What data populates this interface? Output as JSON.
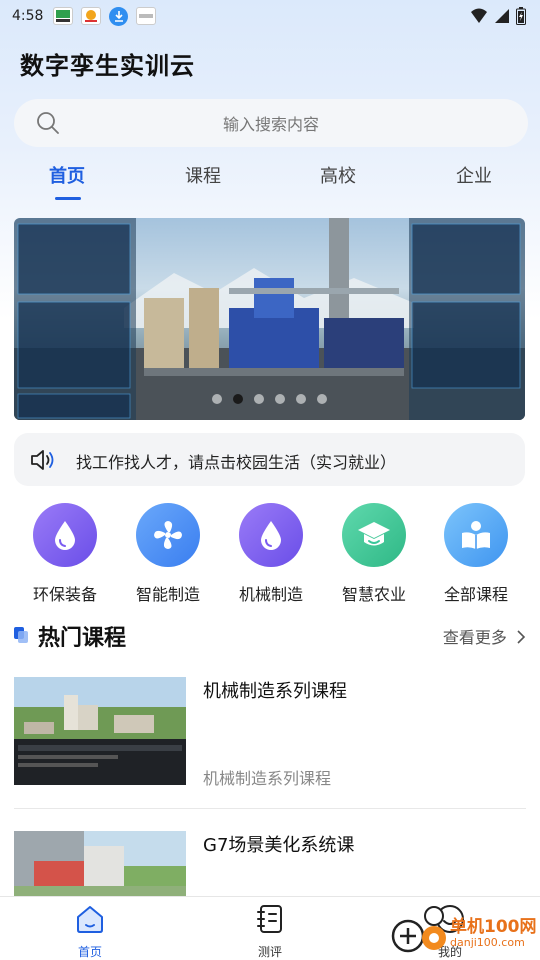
{
  "status_bar": {
    "time": "4:58",
    "app_icons": [
      "notification-app-icon",
      "notification-app-icon",
      "download-icon",
      "notification-app-icon"
    ],
    "right_icons": [
      "wifi-icon",
      "signal-icon",
      "battery-icon"
    ]
  },
  "app": {
    "title": "数字孪生实训云"
  },
  "search": {
    "placeholder": "输入搜索内容"
  },
  "tabs": [
    {
      "label": "首页",
      "active": true
    },
    {
      "label": "课程",
      "active": false
    },
    {
      "label": "高校",
      "active": false
    },
    {
      "label": "企业",
      "active": false
    }
  ],
  "banner": {
    "slide_count": 6,
    "active_index": 1
  },
  "notice": {
    "icon": "speaker-icon",
    "text": "找工作找人才，请点击校园生活（实习就业）"
  },
  "categories": [
    {
      "label": "环保装备",
      "icon": "droplet-icon",
      "color": "#7b5cf0"
    },
    {
      "label": "智能制造",
      "icon": "fan-icon",
      "color": "#4a8ef5"
    },
    {
      "label": "机械制造",
      "icon": "droplet-icon",
      "color": "#7b5cf0"
    },
    {
      "label": "智慧农业",
      "icon": "graduation-cap-icon",
      "color": "#3bc79a"
    },
    {
      "label": "全部课程",
      "icon": "reading-icon",
      "color": "#4aa6f5"
    }
  ],
  "hot_courses": {
    "title": "热门课程",
    "see_more": "查看更多",
    "items": [
      {
        "title": "机械制造系列课程",
        "subtitle": "机械制造系列课程"
      },
      {
        "title": "G7场景美化系统课",
        "subtitle": ""
      }
    ]
  },
  "bottom_nav": [
    {
      "label": "首页",
      "icon": "home-icon",
      "active": true
    },
    {
      "label": "测评",
      "icon": "assessment-icon",
      "active": false
    },
    {
      "label": "我的",
      "icon": "profile-icon",
      "active": false
    }
  ],
  "watermark": {
    "line1": "单机100网",
    "line2": "danji100.com"
  },
  "colors": {
    "accent": "#1f5fe0",
    "background_top": "#dbe9fb"
  }
}
